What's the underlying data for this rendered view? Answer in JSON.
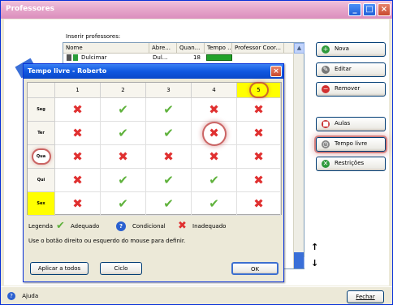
{
  "window": {
    "title": "Professores"
  },
  "main": {
    "insert_label": "Inserir professores:",
    "columns": [
      "Nome",
      "Abre...",
      "Quan...",
      "Tempo ...",
      "Professor Coor..."
    ],
    "first_row": {
      "name": "Dulcimar",
      "abbr": "Dul...",
      "count": "18"
    }
  },
  "side_buttons": {
    "nova": "Nova",
    "editar": "Editar",
    "remover": "Remover",
    "aulas": "Aulas",
    "tempo_livre": "Tempo livre",
    "restricoes": "Restrições"
  },
  "bottom": {
    "ajuda": "Ajuda",
    "fechar": "Fechar"
  },
  "dialog": {
    "title": "Tempo livre - Roberto",
    "columns": [
      "1",
      "2",
      "3",
      "4",
      "5"
    ],
    "rows": [
      "Seg",
      "Ter",
      "Qua",
      "Qui",
      "Sex"
    ],
    "grid": [
      [
        "x",
        "ok",
        "ok",
        "x",
        "x"
      ],
      [
        "x",
        "ok",
        "ok",
        "x",
        "x"
      ],
      [
        "x",
        "x",
        "x",
        "x",
        "x"
      ],
      [
        "x",
        "ok",
        "ok",
        "ok",
        "x"
      ],
      [
        "x",
        "ok",
        "ok",
        "ok",
        "x"
      ]
    ],
    "legend_label": "Legenda",
    "legend_adequado": "Adequado",
    "legend_condicional": "Condicional",
    "legend_inadequado": "Inadequado",
    "hint": "Use o botão direito ou esquerdo do mouse para definir.",
    "apply_all": "Aplicar a todos",
    "ciclo": "Ciclo",
    "ok": "OK"
  },
  "colors": {
    "accent_title": "#e6a7cb",
    "dialog_title": "#1058e0",
    "highlight": "#ffff00"
  }
}
